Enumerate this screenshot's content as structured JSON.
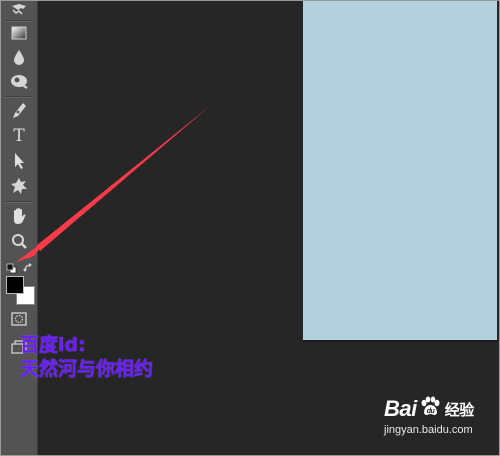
{
  "toolbar": {
    "tools": [
      {
        "id": "stamp",
        "icon": "clone-stamp-icon"
      },
      {
        "id": "gradient",
        "icon": "gradient-icon"
      },
      {
        "id": "blur",
        "icon": "blur-drop-icon"
      },
      {
        "id": "dodge",
        "icon": "dodge-icon"
      },
      {
        "id": "pen",
        "icon": "pen-icon"
      },
      {
        "id": "type",
        "icon": "type-icon",
        "glyph": "T"
      },
      {
        "id": "select",
        "icon": "path-selection-icon"
      },
      {
        "id": "shape",
        "icon": "custom-shape-icon"
      },
      {
        "id": "hand",
        "icon": "hand-icon"
      },
      {
        "id": "zoom",
        "icon": "zoom-icon"
      },
      {
        "id": "quickmask",
        "icon": "quick-mask-icon"
      },
      {
        "id": "screenmode",
        "icon": "screen-mode-icon"
      }
    ],
    "foreground_color": "#000000",
    "background_color": "#ffffff"
  },
  "canvas": {
    "color": "#b3d2de"
  },
  "annotation": {
    "line1": "百度id:",
    "line2": "天然河与你相约",
    "color": "#6a1dff",
    "arrow_color": "#ff3b4a"
  },
  "watermark": {
    "logo_part1": "Bai",
    "logo_part2": "经验",
    "url": "jingyan.baidu.com"
  }
}
